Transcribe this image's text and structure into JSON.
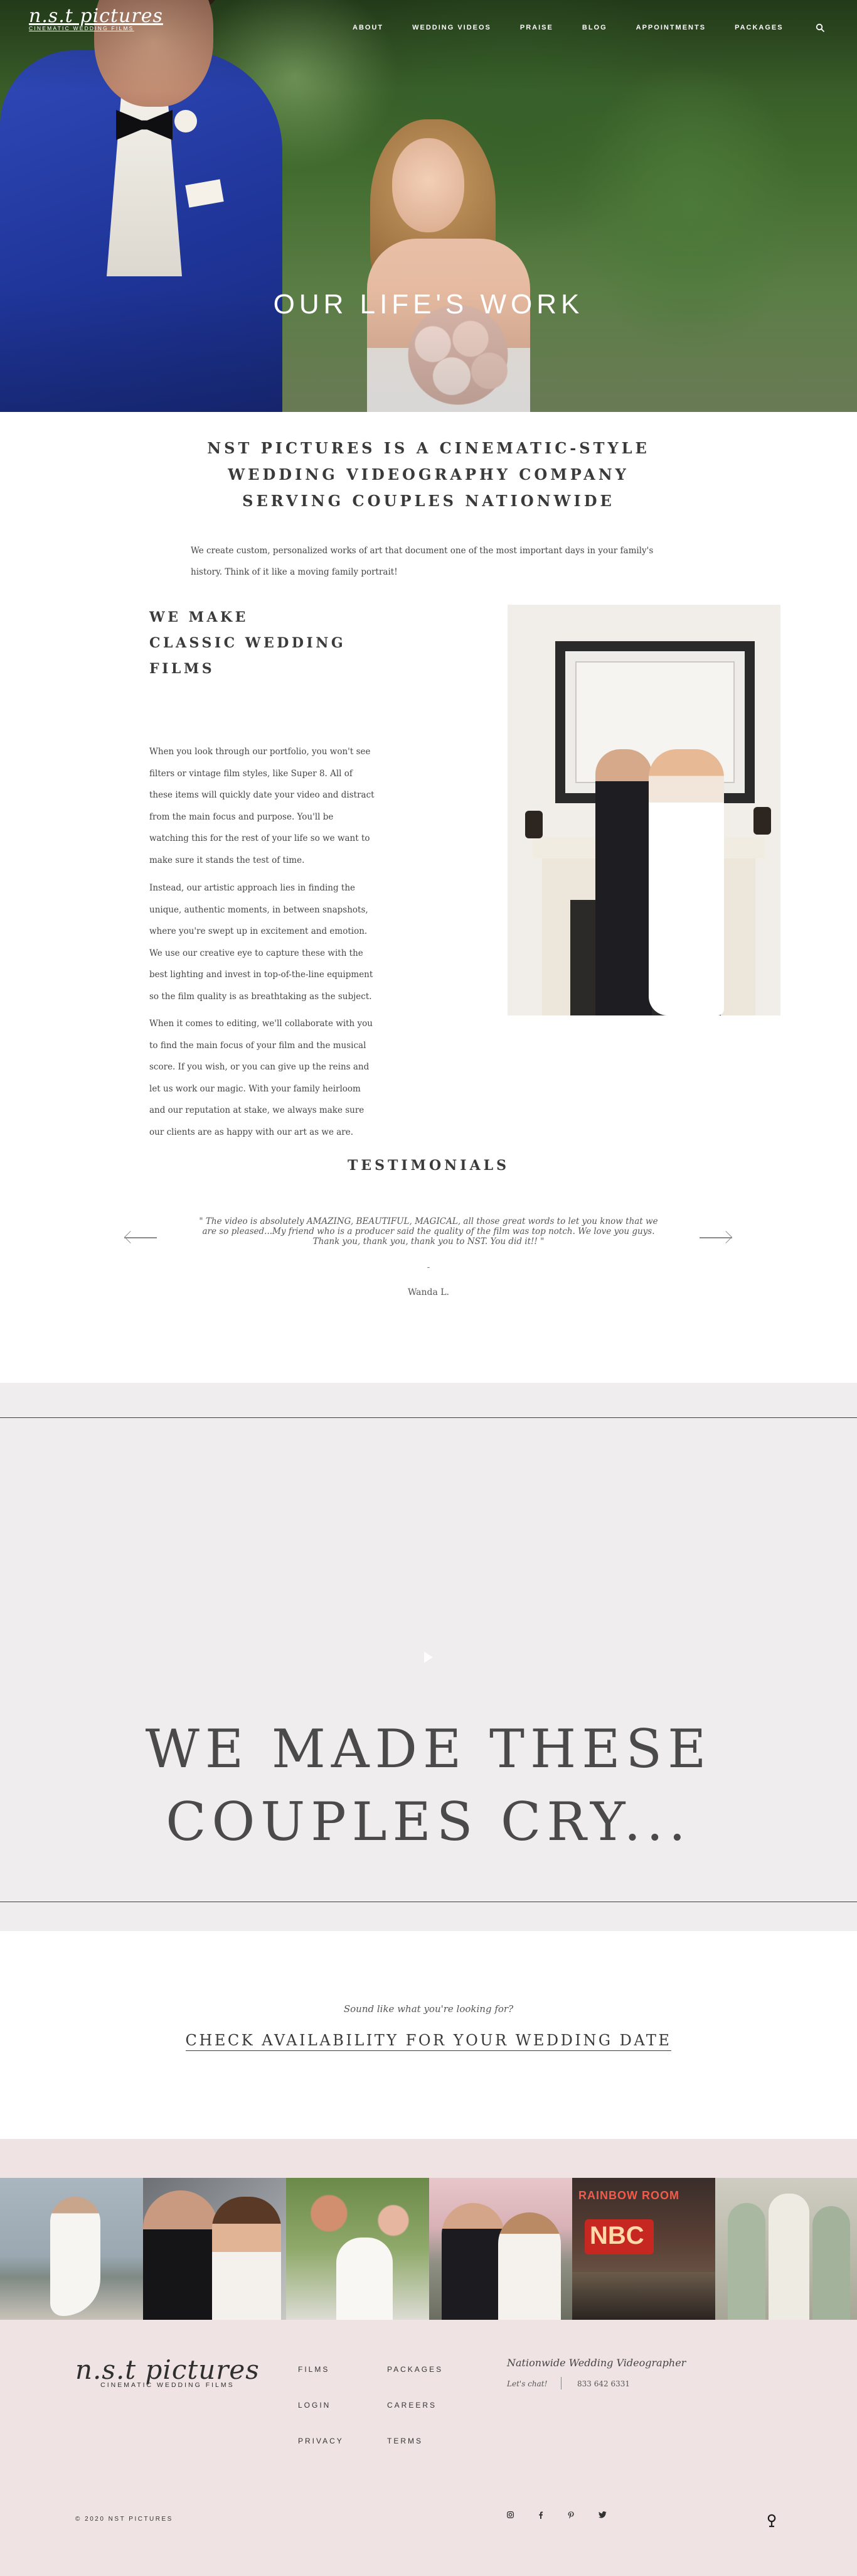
{
  "header": {
    "logo_script": "n.s.t pictures",
    "logo_tagline": "CINEMATIC WEDDING FILMS",
    "nav": [
      "ABOUT",
      "WEDDING VIDEOS",
      "PRAISE",
      "BLOG",
      "APPOINTMENTS",
      "PACKAGES"
    ],
    "search_icon": "search-icon"
  },
  "hero": {
    "title": "OUR LIFE'S WORK"
  },
  "intro": {
    "heading": "NST PICTURES IS A CINEMATIC-STYLE WEDDING VIDEOGRAPHY COMPANY SERVING COUPLES NATIONWIDE",
    "text": "We create custom, personalized works of art that document one of the most important days in your family's history. Think of it like a moving family portrait!"
  },
  "classic": {
    "heading_lines": [
      "WE MAKE",
      "CLASSIC WEDDING",
      "FILMS"
    ],
    "paragraphs": [
      "When you look through our portfolio, you won't see filters or vintage film styles, like Super 8. All of these items will quickly date your video and distract from the main focus and purpose. You'll be watching this for the rest of your life so we want to make sure it stands the test of time.",
      "Instead, our artistic approach lies in finding the unique, authentic moments, in between snapshots, where you're swept up in excitement and emotion. We use our creative eye to capture these with the best lighting and invest in top-of-the-line equipment so the film quality is as breathtaking as the subject.",
      "When it comes to editing, we'll collaborate with you to find the main focus of your film and the musical score. If you wish, or you can give up the reins and let us work our magic. With your family heirloom and our reputation at stake, we always make sure our clients are as happy with our art as we are."
    ]
  },
  "testimonials": {
    "heading": "TESTIMONIALS",
    "quote": "\" The video is absolutely AMAZING, BEAUTIFUL, MAGICAL, all those great words to let you know that we are so pleased...My friend who is a producer said the quality of the film was top notch. We love you guys. Thank you, thank you, thank you to NST. You did it!! \"",
    "separator": "-",
    "author": "Wanda L."
  },
  "video": {
    "title_lines": [
      "WE MADE THESE",
      "COUPLES CRY..."
    ]
  },
  "cta": {
    "sub": "Sound like what you're looking for?",
    "link": "CHECK AVAILABILITY FOR YOUR WEDDING DATE"
  },
  "footer": {
    "logo_script": "n.s.t pictures",
    "logo_tagline": "CINEMATIC WEDDING FILMS",
    "links_col1": [
      "FILMS",
      "LOGIN",
      "PRIVACY"
    ],
    "links_col2": [
      "PACKAGES",
      "CAREERS",
      "TERMS"
    ],
    "tagline": "Nationwide Wedding Videographer",
    "chat": "Let's chat!",
    "phone": "833 642 6331",
    "copyright": "© 2020 NST PICTURES",
    "social": [
      "ig",
      "f",
      "p",
      "twitter"
    ],
    "social_icons": [
      "instagram-icon",
      "facebook-icon",
      "pinterest-icon",
      "twitter-icon"
    ],
    "ngo_icon": "search-icon"
  },
  "colors": {
    "accent_text": "#3a3a3a",
    "footer_bg": "#efe4e3",
    "video_bg": "#efeded"
  }
}
